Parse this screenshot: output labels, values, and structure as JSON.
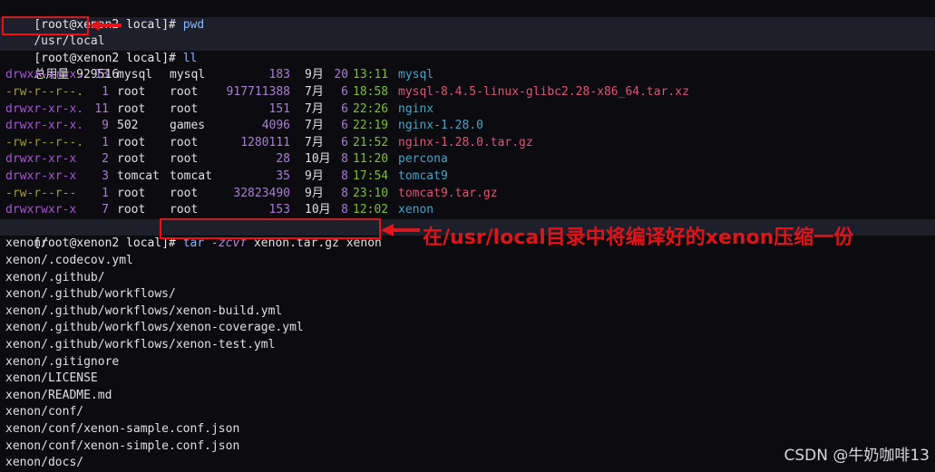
{
  "prompt": "[root@xenon2 local]# ",
  "cmd1": "pwd",
  "pwd_output": "/usr/local",
  "cmd2": "ll",
  "total_line": "总用量 929516",
  "listing": [
    {
      "perm": "drwxr-xr-x.",
      "links": "13",
      "user": "mysql",
      "group": "mysql",
      "size": "183",
      "month": "9月",
      "day": "20",
      "time": "13:11",
      "name": "mysql",
      "kind": "dir"
    },
    {
      "perm": "-rw-r--r--.",
      "links": "1",
      "user": "root",
      "group": "root",
      "size": "917711388",
      "month": "7月",
      "day": "6",
      "time": "18:58",
      "name": "mysql-8.4.5-linux-glibc2.28-x86_64.tar.xz",
      "kind": "archive"
    },
    {
      "perm": "drwxr-xr-x.",
      "links": "11",
      "user": "root",
      "group": "root",
      "size": "151",
      "month": "7月",
      "day": "6",
      "time": "22:26",
      "name": "nginx",
      "kind": "dir"
    },
    {
      "perm": "drwxr-xr-x.",
      "links": "9",
      "user": "502",
      "group": "games",
      "size": "4096",
      "month": "7月",
      "day": "6",
      "time": "22:19",
      "name": "nginx-1.28.0",
      "kind": "dir"
    },
    {
      "perm": "-rw-r--r--.",
      "links": "1",
      "user": "root",
      "group": "root",
      "size": "1280111",
      "month": "7月",
      "day": "6",
      "time": "21:52",
      "name": "nginx-1.28.0.tar.gz",
      "kind": "archive"
    },
    {
      "perm": "drwxr-xr-x",
      "links": "2",
      "user": "root",
      "group": "root",
      "size": "28",
      "month": "10月",
      "day": "8",
      "time": "11:20",
      "name": "percona",
      "kind": "dir"
    },
    {
      "perm": "drwxr-xr-x",
      "links": "3",
      "user": "tomcat",
      "group": "tomcat",
      "size": "35",
      "month": "9月",
      "day": "8",
      "time": "17:54",
      "name": "tomcat9",
      "kind": "dir"
    },
    {
      "perm": "-rw-r--r--",
      "links": "1",
      "user": "root",
      "group": "root",
      "size": "32823490",
      "month": "9月",
      "day": "8",
      "time": "23:10",
      "name": "tomcat9.tar.gz",
      "kind": "archive"
    },
    {
      "perm": "drwxrwxr-x",
      "links": "7",
      "user": "root",
      "group": "root",
      "size": "153",
      "month": "10月",
      "day": "8",
      "time": "12:02",
      "name": "xenon",
      "kind": "dir"
    }
  ],
  "cmd3": {
    "tar": "tar",
    "flags": "-zcvf",
    "args": "xenon.tar.gz xenon"
  },
  "tar_output": [
    "xenon/",
    "xenon/.codecov.yml",
    "xenon/.github/",
    "xenon/.github/workflows/",
    "xenon/.github/workflows/xenon-build.yml",
    "xenon/.github/workflows/xenon-coverage.yml",
    "xenon/.github/workflows/xenon-test.yml",
    "xenon/.gitignore",
    "xenon/LICENSE",
    "xenon/README.md",
    "xenon/conf/",
    "xenon/conf/xenon-sample.conf.json",
    "xenon/conf/xenon-simple.conf.json",
    "xenon/docs/"
  ],
  "annotation": "在/usr/local目录中将编译好的xenon压缩一份",
  "watermark": "CSDN @牛奶咖啡13",
  "colors": {
    "annotation_red": "#e0141a",
    "background": "#0b0b10"
  }
}
